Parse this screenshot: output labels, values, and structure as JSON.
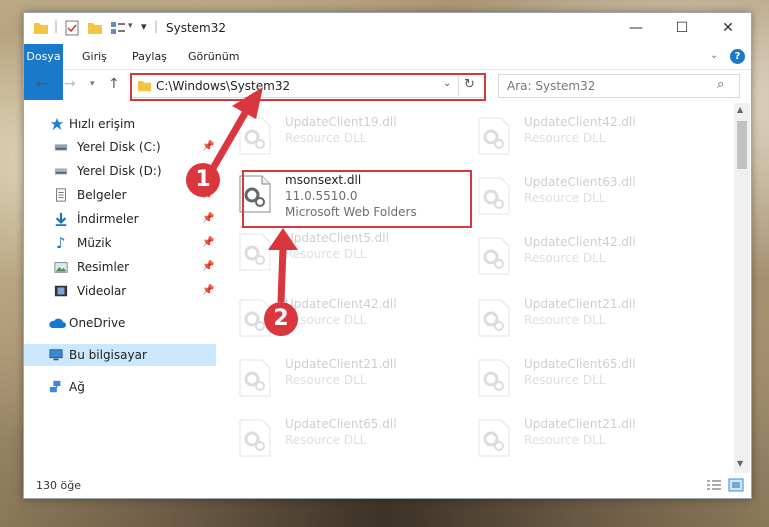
{
  "window": {
    "title": "System32"
  },
  "ribbon": {
    "tabs": [
      "Dosya",
      "Giriş",
      "Paylaş",
      "Görünüm"
    ]
  },
  "address": {
    "path": "C:\\Windows\\System32"
  },
  "search": {
    "placeholder": "Ara: System32"
  },
  "sidebar": {
    "items": [
      {
        "label": "Hızlı erişim",
        "icon": "star-icon",
        "pinned": false
      },
      {
        "label": "Yerel Disk (C:)",
        "icon": "drive-icon",
        "pinned": true
      },
      {
        "label": "Yerel Disk (D:)",
        "icon": "drive-icon",
        "pinned": false
      },
      {
        "label": "Belgeler",
        "icon": "document-icon",
        "pinned": true
      },
      {
        "label": "İndirmeler",
        "icon": "download-icon",
        "pinned": true
      },
      {
        "label": "Müzik",
        "icon": "music-icon",
        "pinned": true
      },
      {
        "label": "Resimler",
        "icon": "picture-icon",
        "pinned": true
      },
      {
        "label": "Videolar",
        "icon": "video-icon",
        "pinned": true
      },
      {
        "label": "OneDrive",
        "icon": "cloud-icon",
        "pinned": false
      },
      {
        "label": "Bu bilgisayar",
        "icon": "computer-icon",
        "pinned": false
      },
      {
        "label": "Ağ",
        "icon": "network-icon",
        "pinned": false
      }
    ]
  },
  "files": {
    "highlighted": {
      "name": "msonsext.dll",
      "version": "11.0.5510.0",
      "desc": "Microsoft Web Folders"
    },
    "left": [
      {
        "name": "UpdateClient19.dll",
        "desc": "Resource DLL"
      },
      {
        "name": "UpdateClient5.dll",
        "desc": "Resource DLL"
      },
      {
        "name": "UpdateClient42.dll",
        "desc": "Resource DLL"
      },
      {
        "name": "UpdateClient21.dll",
        "desc": "Resource DLL"
      },
      {
        "name": "UpdateClient65.dll",
        "desc": "Resource DLL"
      }
    ],
    "right": [
      {
        "name": "UpdateClient42.dll",
        "desc": "Resource DLL"
      },
      {
        "name": "UpdateClient63.dll",
        "desc": "Resource DLL"
      },
      {
        "name": "UpdateClient42.dll",
        "desc": "Resource DLL"
      },
      {
        "name": "UpdateClient21.dll",
        "desc": "Resource DLL"
      },
      {
        "name": "UpdateClient65.dll",
        "desc": "Resource DLL"
      },
      {
        "name": "UpdateClient21.dll",
        "desc": "Resource DLL"
      }
    ]
  },
  "status": {
    "count": "130 öğe"
  },
  "annotations": {
    "step1": "1",
    "step2": "2",
    "color": "#d9363e"
  }
}
